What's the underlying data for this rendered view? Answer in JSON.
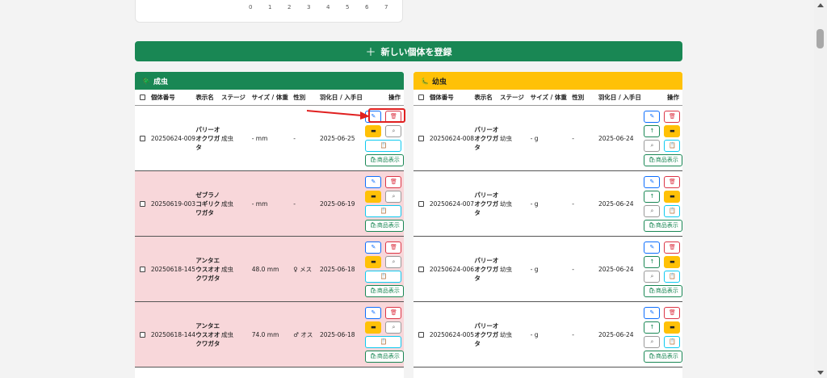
{
  "chart_ticks": [
    "0",
    "1",
    "2",
    "3",
    "4",
    "5",
    "6",
    "7"
  ],
  "register_button": "新しい個体を登録",
  "adult_panel": {
    "title": "成虫",
    "columns": [
      "個体番号",
      "表示名",
      "ステージ",
      "サイズ / 体重",
      "性別",
      "羽化日 / 入手日",
      "操作"
    ],
    "rows": [
      {
        "id": "20250624-009",
        "name": "パリーオオクワガタ",
        "stage": "成虫",
        "size": "- mm",
        "sex": "-",
        "date": "2025-06-25",
        "pink": false
      },
      {
        "id": "20250619-003",
        "name": "ゼブラノコギリクワガタ",
        "stage": "成虫",
        "size": "- mm",
        "sex": "-",
        "date": "2025-06-19",
        "pink": true
      },
      {
        "id": "20250618-145",
        "name": "アンタエウスオオクワガタ",
        "stage": "成虫",
        "size": "48.0 mm",
        "sex": "♀ メス",
        "date": "2025-06-18",
        "pink": true
      },
      {
        "id": "20250618-144",
        "name": "アンタエウスオオクワガタ",
        "stage": "成虫",
        "size": "74.0 mm",
        "sex": "♂ オス",
        "date": "2025-06-18",
        "pink": true
      }
    ]
  },
  "larva_panel": {
    "title": "幼虫",
    "columns": [
      "個体番号",
      "表示名",
      "ステージ",
      "サイズ / 体重",
      "性別",
      "羽化日 / 入手日",
      "操作"
    ],
    "rows": [
      {
        "id": "20250624-008",
        "name": "パリーオオクワガタ",
        "stage": "幼虫",
        "size": "- g",
        "sex": "-",
        "date": "2025-06-24"
      },
      {
        "id": "20250624-007",
        "name": "パリーオオクワガタ",
        "stage": "幼虫",
        "size": "- g",
        "sex": "-",
        "date": "2025-06-24"
      },
      {
        "id": "20250624-006",
        "name": "パリーオオクワガタ",
        "stage": "幼虫",
        "size": "- g",
        "sex": "-",
        "date": "2025-06-24"
      },
      {
        "id": "20250624-005",
        "name": "パリーオオクワガタ",
        "stage": "幼虫",
        "size": "- g",
        "sex": "-",
        "date": "2025-06-24"
      }
    ]
  },
  "product_label": "商品表示",
  "colors": {
    "adult_header": "#198754",
    "larva_header": "#ffc107",
    "pink_row": "#f8d7da",
    "highlight": "#e02020"
  }
}
